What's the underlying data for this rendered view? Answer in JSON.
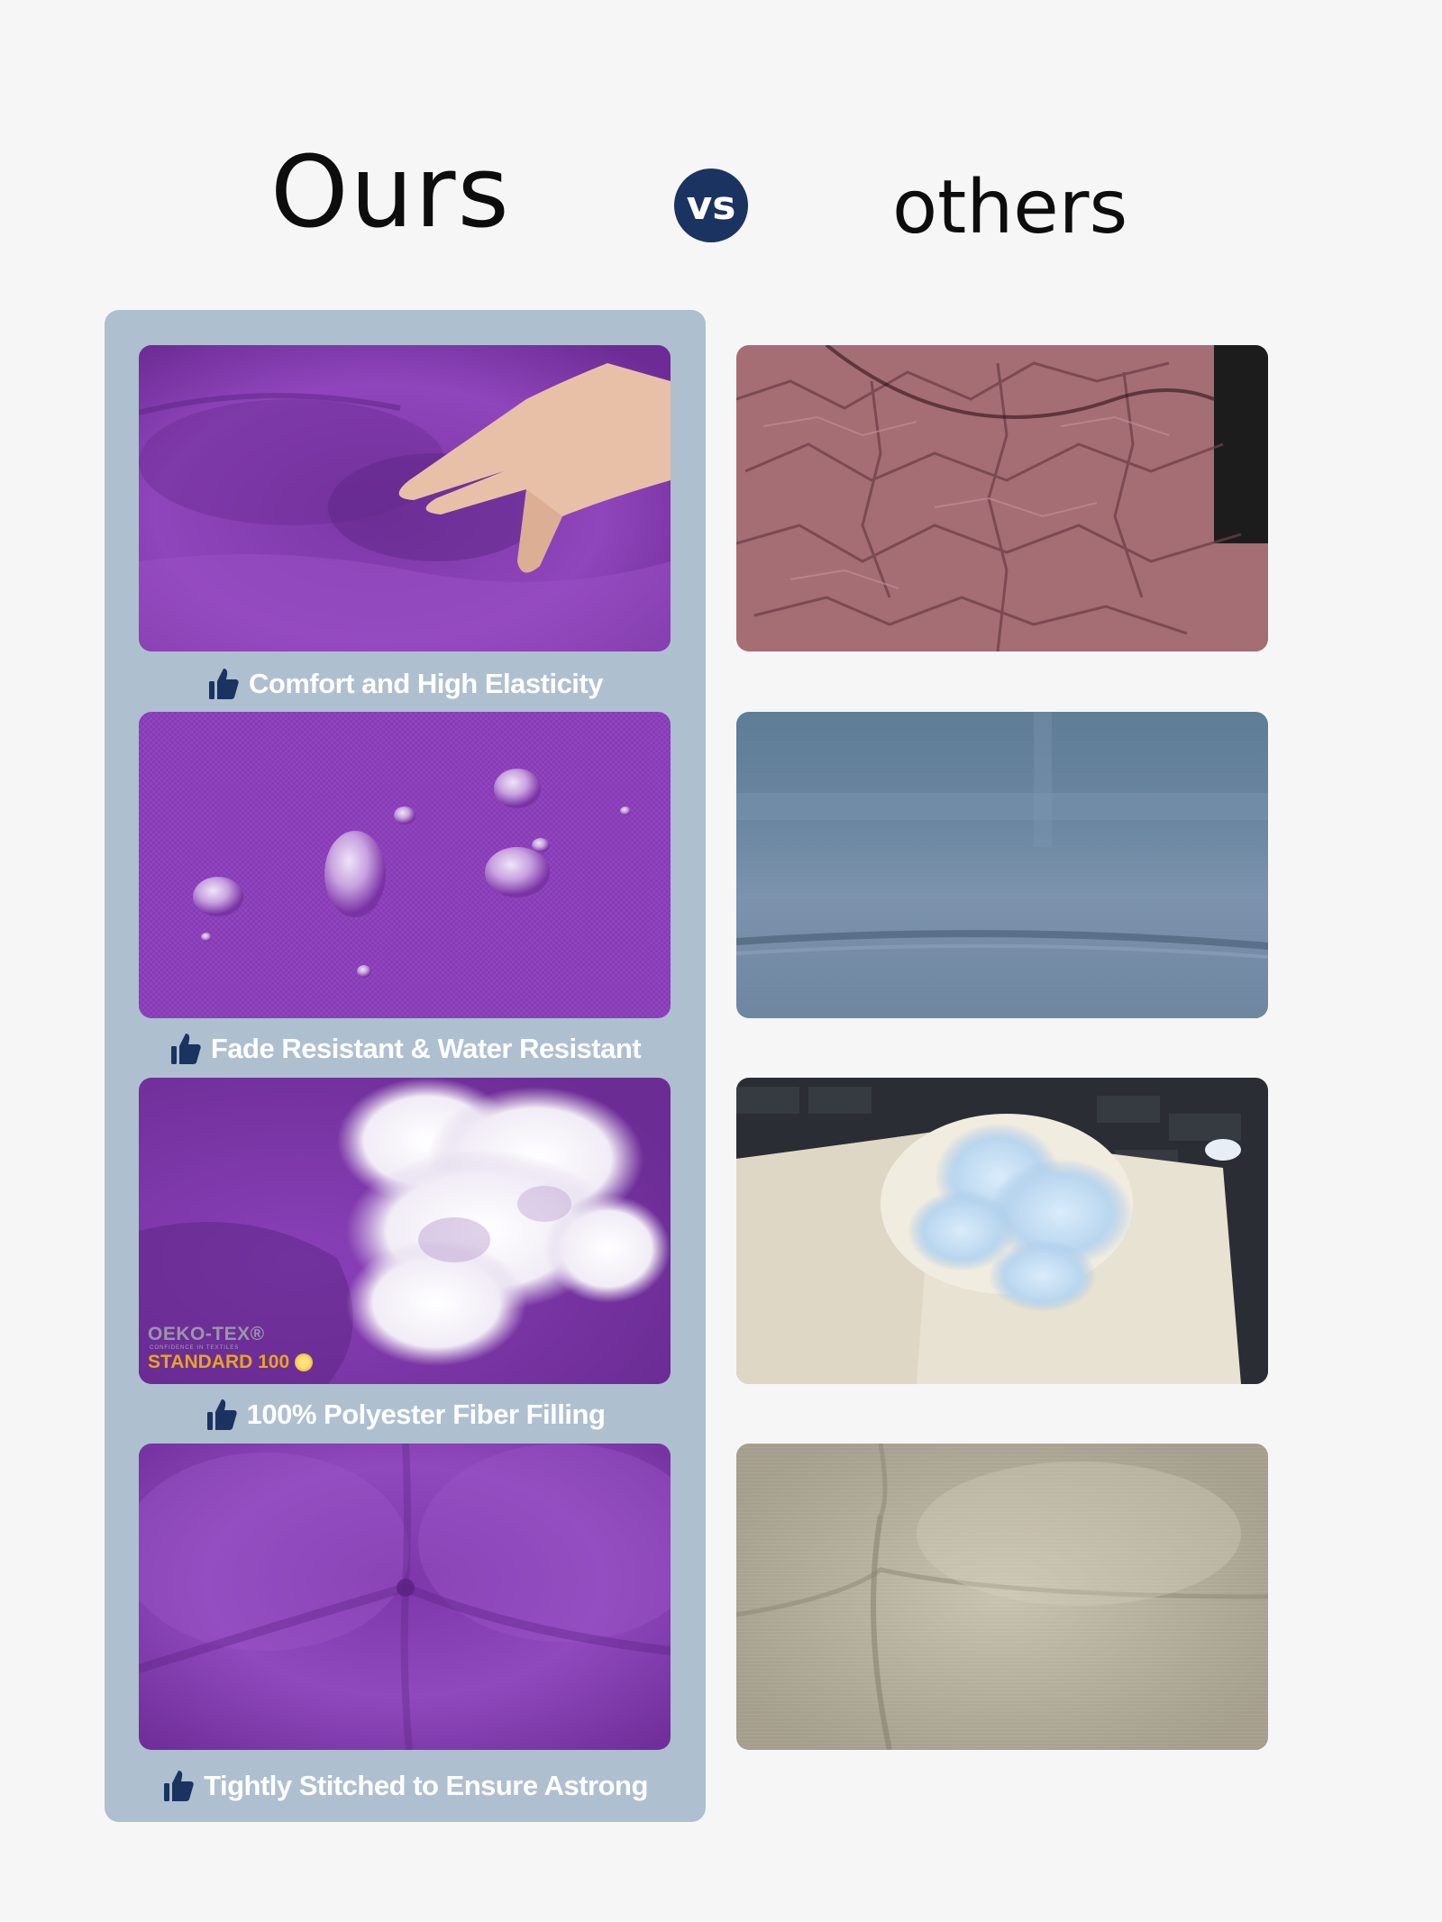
{
  "header": {
    "ours": "Ours",
    "vs": "vs",
    "others": "others"
  },
  "ours": [
    {
      "caption": "Comfort and High Elasticity",
      "photo": "purple-cushion-pressed-by-hand"
    },
    {
      "caption": "Fade Resistant & Water Resistant",
      "photo": "purple-fabric-water-droplets"
    },
    {
      "caption": "100% Polyester Fiber Filling",
      "photo": "purple-cushion-fiber-filling"
    },
    {
      "caption": "Tightly Stitched to Ensure Astrong",
      "photo": "purple-tufted-cushion"
    }
  ],
  "others": [
    {
      "photo": "wrinkled-pink-cushion"
    },
    {
      "photo": "faded-blue-cushion"
    },
    {
      "photo": "torn-white-cushion-filling"
    },
    {
      "photo": "beige-tufted-cushion"
    }
  ],
  "badge": {
    "line1": "OEKO-TEX®",
    "line0": "CONFIDENCE IN TEXTILES",
    "line2": "STANDARD 100"
  },
  "colors": {
    "panel": "#aebfd0",
    "vs_badge": "#1b3360",
    "icon": "#1b3360",
    "purple": "#8a3fb7"
  },
  "icons": {
    "caption": "thumbs-up-icon"
  }
}
